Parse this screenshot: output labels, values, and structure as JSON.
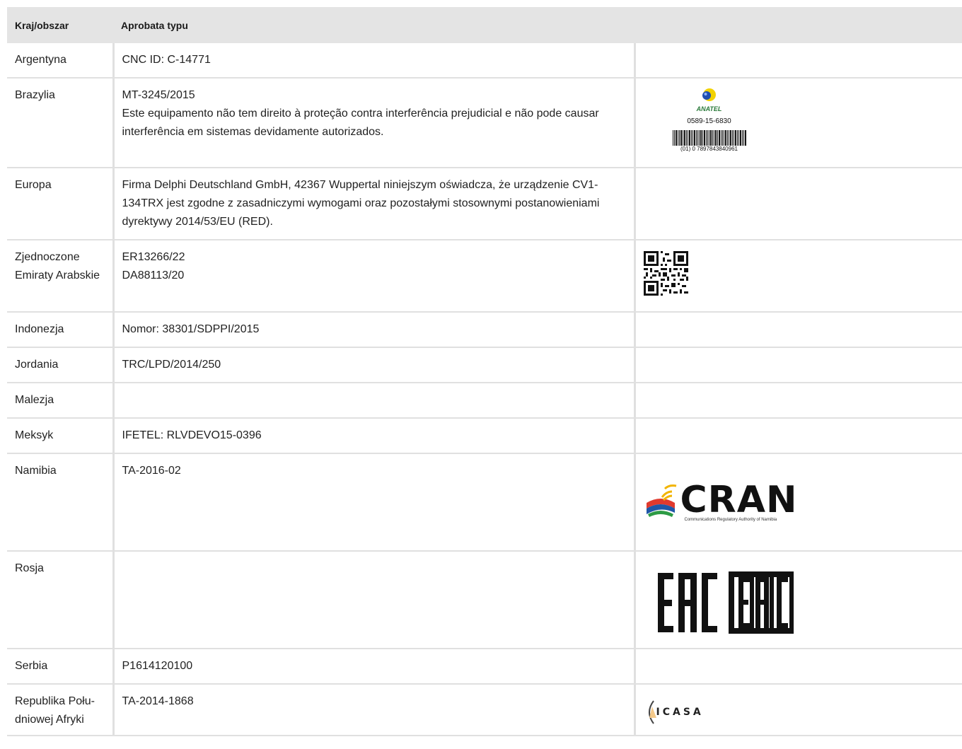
{
  "table": {
    "headers": {
      "country": "Kraj/obszar",
      "approval": "Aprobata typu"
    },
    "rows": [
      {
        "country": "Argentyna",
        "approval": [
          "CNC ID: C-14771"
        ]
      },
      {
        "country": "Brazylia",
        "approval": [
          "MT-3245/2015",
          "Este equipamento não tem direito à proteção contra interferência prejudicial e não pode causar interferência em sistemas devidamente autorizados."
        ]
      },
      {
        "country": "Europa",
        "approval": [
          "Firma Delphi Deutschland GmbH, 42367 Wuppertal niniejszym oświadcza, że urządzenie CV1-134TRX jest zgodne z zasadniczymi wymogami oraz pozostałymi stosownymi po­stanowieniami dyrektywy 2014/53/EU (RED)."
        ]
      },
      {
        "country": "Zjednoczone Emiraty Arabskie",
        "approval": [
          "ER13266/22",
          "DA88113/20"
        ]
      },
      {
        "country": "Indonezja",
        "approval": [
          "Nomor: 38301/SDPPI/2015"
        ]
      },
      {
        "country": "Jordania",
        "approval": [
          "TRC/LPD/2014/250"
        ]
      },
      {
        "country": "Malezja",
        "approval": []
      },
      {
        "country": "Meksyk",
        "approval": [
          "IFETEL: RLVDEVO15-0396"
        ]
      },
      {
        "country": "Namibia",
        "approval": [
          "TA-2016-02"
        ]
      },
      {
        "country": "Rosja",
        "approval": []
      },
      {
        "country": "Serbia",
        "approval": [
          "P1614120100"
        ]
      },
      {
        "country": "Republika Połu­dniowej Afryki",
        "approval": [
          "TA-2014-1868"
        ]
      }
    ]
  },
  "marks": {
    "anatel": {
      "name": "ANATEL",
      "code": "0589-15-6830",
      "barcode_text": "(01) 0 7897843840961"
    },
    "cran": {
      "name": "CRAN",
      "subtitle": "Communications Regulatory Authority of Namibia"
    },
    "eac": {
      "text": "EAC"
    },
    "icasa": {
      "text": "ICASA"
    }
  }
}
